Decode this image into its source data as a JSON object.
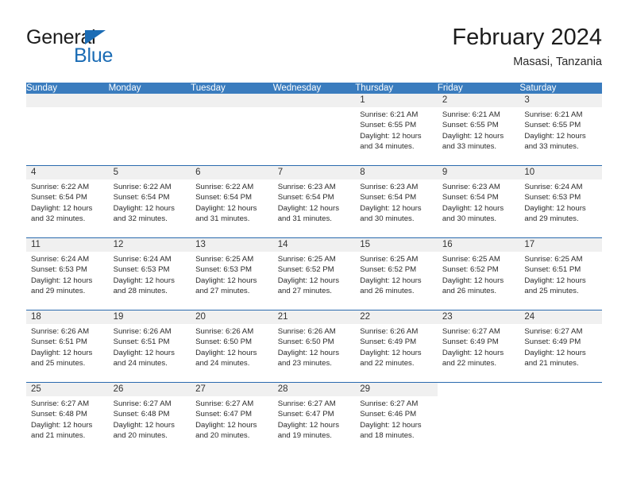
{
  "brand": {
    "name_part1": "General",
    "name_part2": "Blue",
    "triangle_icon": "triangle-icon",
    "color_dark": "#1d1d1d",
    "color_blue": "#1b6cb5"
  },
  "header": {
    "title": "February 2024",
    "subtitle": "Masasi, Tanzania"
  },
  "theme": {
    "header_bg": "#3a7cbe",
    "row_divider": "#2a6aae",
    "daynum_bg": "#f0f0f0",
    "page_bg": "#ffffff"
  },
  "weekday_headers": [
    "Sunday",
    "Monday",
    "Tuesday",
    "Wednesday",
    "Thursday",
    "Friday",
    "Saturday"
  ],
  "labels": {
    "sunrise": "Sunrise:",
    "sunset": "Sunset:",
    "daylight": "Daylight:"
  },
  "weeks": [
    [
      {
        "day": "",
        "empty": true
      },
      {
        "day": "",
        "empty": true
      },
      {
        "day": "",
        "empty": true
      },
      {
        "day": "",
        "empty": true
      },
      {
        "day": "1",
        "sunrise": "Sunrise: 6:21 AM",
        "sunset": "Sunset: 6:55 PM",
        "daylight": "Daylight: 12 hours and 34 minutes."
      },
      {
        "day": "2",
        "sunrise": "Sunrise: 6:21 AM",
        "sunset": "Sunset: 6:55 PM",
        "daylight": "Daylight: 12 hours and 33 minutes."
      },
      {
        "day": "3",
        "sunrise": "Sunrise: 6:21 AM",
        "sunset": "Sunset: 6:55 PM",
        "daylight": "Daylight: 12 hours and 33 minutes."
      }
    ],
    [
      {
        "day": "4",
        "sunrise": "Sunrise: 6:22 AM",
        "sunset": "Sunset: 6:54 PM",
        "daylight": "Daylight: 12 hours and 32 minutes."
      },
      {
        "day": "5",
        "sunrise": "Sunrise: 6:22 AM",
        "sunset": "Sunset: 6:54 PM",
        "daylight": "Daylight: 12 hours and 32 minutes."
      },
      {
        "day": "6",
        "sunrise": "Sunrise: 6:22 AM",
        "sunset": "Sunset: 6:54 PM",
        "daylight": "Daylight: 12 hours and 31 minutes."
      },
      {
        "day": "7",
        "sunrise": "Sunrise: 6:23 AM",
        "sunset": "Sunset: 6:54 PM",
        "daylight": "Daylight: 12 hours and 31 minutes."
      },
      {
        "day": "8",
        "sunrise": "Sunrise: 6:23 AM",
        "sunset": "Sunset: 6:54 PM",
        "daylight": "Daylight: 12 hours and 30 minutes."
      },
      {
        "day": "9",
        "sunrise": "Sunrise: 6:23 AM",
        "sunset": "Sunset: 6:54 PM",
        "daylight": "Daylight: 12 hours and 30 minutes."
      },
      {
        "day": "10",
        "sunrise": "Sunrise: 6:24 AM",
        "sunset": "Sunset: 6:53 PM",
        "daylight": "Daylight: 12 hours and 29 minutes."
      }
    ],
    [
      {
        "day": "11",
        "sunrise": "Sunrise: 6:24 AM",
        "sunset": "Sunset: 6:53 PM",
        "daylight": "Daylight: 12 hours and 29 minutes."
      },
      {
        "day": "12",
        "sunrise": "Sunrise: 6:24 AM",
        "sunset": "Sunset: 6:53 PM",
        "daylight": "Daylight: 12 hours and 28 minutes."
      },
      {
        "day": "13",
        "sunrise": "Sunrise: 6:25 AM",
        "sunset": "Sunset: 6:53 PM",
        "daylight": "Daylight: 12 hours and 27 minutes."
      },
      {
        "day": "14",
        "sunrise": "Sunrise: 6:25 AM",
        "sunset": "Sunset: 6:52 PM",
        "daylight": "Daylight: 12 hours and 27 minutes."
      },
      {
        "day": "15",
        "sunrise": "Sunrise: 6:25 AM",
        "sunset": "Sunset: 6:52 PM",
        "daylight": "Daylight: 12 hours and 26 minutes."
      },
      {
        "day": "16",
        "sunrise": "Sunrise: 6:25 AM",
        "sunset": "Sunset: 6:52 PM",
        "daylight": "Daylight: 12 hours and 26 minutes."
      },
      {
        "day": "17",
        "sunrise": "Sunrise: 6:25 AM",
        "sunset": "Sunset: 6:51 PM",
        "daylight": "Daylight: 12 hours and 25 minutes."
      }
    ],
    [
      {
        "day": "18",
        "sunrise": "Sunrise: 6:26 AM",
        "sunset": "Sunset: 6:51 PM",
        "daylight": "Daylight: 12 hours and 25 minutes."
      },
      {
        "day": "19",
        "sunrise": "Sunrise: 6:26 AM",
        "sunset": "Sunset: 6:51 PM",
        "daylight": "Daylight: 12 hours and 24 minutes."
      },
      {
        "day": "20",
        "sunrise": "Sunrise: 6:26 AM",
        "sunset": "Sunset: 6:50 PM",
        "daylight": "Daylight: 12 hours and 24 minutes."
      },
      {
        "day": "21",
        "sunrise": "Sunrise: 6:26 AM",
        "sunset": "Sunset: 6:50 PM",
        "daylight": "Daylight: 12 hours and 23 minutes."
      },
      {
        "day": "22",
        "sunrise": "Sunrise: 6:26 AM",
        "sunset": "Sunset: 6:49 PM",
        "daylight": "Daylight: 12 hours and 22 minutes."
      },
      {
        "day": "23",
        "sunrise": "Sunrise: 6:27 AM",
        "sunset": "Sunset: 6:49 PM",
        "daylight": "Daylight: 12 hours and 22 minutes."
      },
      {
        "day": "24",
        "sunrise": "Sunrise: 6:27 AM",
        "sunset": "Sunset: 6:49 PM",
        "daylight": "Daylight: 12 hours and 21 minutes."
      }
    ],
    [
      {
        "day": "25",
        "sunrise": "Sunrise: 6:27 AM",
        "sunset": "Sunset: 6:48 PM",
        "daylight": "Daylight: 12 hours and 21 minutes."
      },
      {
        "day": "26",
        "sunrise": "Sunrise: 6:27 AM",
        "sunset": "Sunset: 6:48 PM",
        "daylight": "Daylight: 12 hours and 20 minutes."
      },
      {
        "day": "27",
        "sunrise": "Sunrise: 6:27 AM",
        "sunset": "Sunset: 6:47 PM",
        "daylight": "Daylight: 12 hours and 20 minutes."
      },
      {
        "day": "28",
        "sunrise": "Sunrise: 6:27 AM",
        "sunset": "Sunset: 6:47 PM",
        "daylight": "Daylight: 12 hours and 19 minutes."
      },
      {
        "day": "29",
        "sunrise": "Sunrise: 6:27 AM",
        "sunset": "Sunset: 6:46 PM",
        "daylight": "Daylight: 12 hours and 18 minutes."
      },
      {
        "day": "",
        "empty": true,
        "blank": true
      },
      {
        "day": "",
        "empty": true,
        "blank": true
      }
    ]
  ]
}
